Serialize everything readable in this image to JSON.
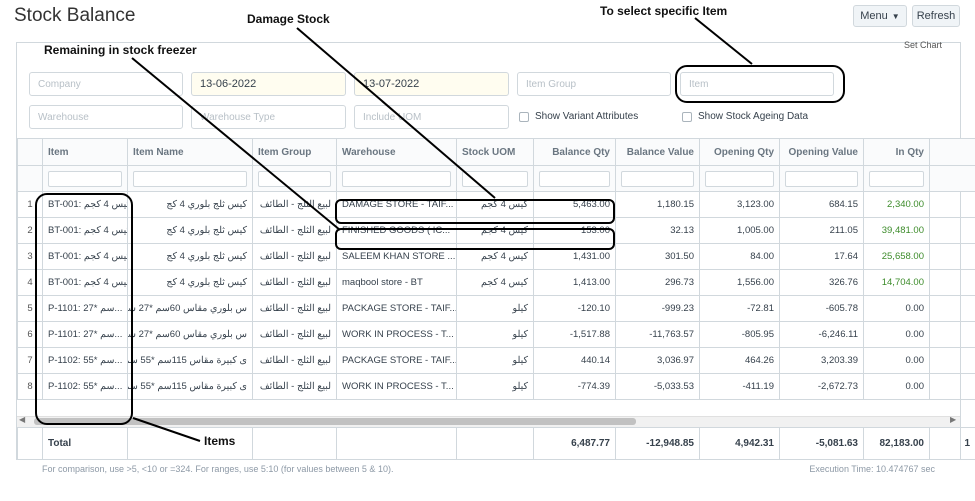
{
  "page": {
    "title": "Stock Balance",
    "menu_label": "Menu",
    "refresh_label": "Refresh",
    "set_chart_label": "Set Chart"
  },
  "filters": {
    "company_placeholder": "Company",
    "from_date": "13-06-2022",
    "to_date": "13-07-2022",
    "item_group_placeholder": "Item Group",
    "item_placeholder": "Item",
    "warehouse_placeholder": "Warehouse",
    "warehouse_type_placeholder": "Warehouse Type",
    "include_uom_placeholder": "Include UOM",
    "show_variant_label": "Show Variant Attributes",
    "show_ageing_label": "Show Stock Ageing Data"
  },
  "table": {
    "columns": [
      "Item",
      "Item Name",
      "Item Group",
      "Warehouse",
      "Stock UOM",
      "Balance Qty",
      "Balance Value",
      "Opening Qty",
      "Opening Value",
      "In Qty"
    ],
    "rows": [
      {
        "idx": "1",
        "item": "BT-001: كيس 4 كجم...",
        "name": "كيس ثلج بلوري 4 كج",
        "group": "لبيع الثلج - الطائف",
        "warehouse": "DAMAGE STORE - TAIF...",
        "uom": "كيس 4 كجم",
        "bal_qty": "5,463.00",
        "bal_val": "1,180.15",
        "open_qty": "3,123.00",
        "open_val": "684.15",
        "in_qty": "2,340.00"
      },
      {
        "idx": "2",
        "item": "BT-001: كيس 4 كجم...",
        "name": "كيس ثلج بلوري 4 كج",
        "group": "لبيع الثلج - الطائف",
        "warehouse": "FINISHED GOODS ( IC...",
        "uom": "كيس 4 كجم",
        "bal_qty": "153.00",
        "bal_val": "32.13",
        "open_qty": "1,005.00",
        "open_val": "211.05",
        "in_qty": "39,481.00"
      },
      {
        "idx": "3",
        "item": "BT-001: كيس 4 كجم...",
        "name": "كيس ثلج بلوري 4 كج",
        "group": "لبيع الثلج - الطائف",
        "warehouse": "SALEEM KHAN STORE ...",
        "uom": "كيس 4 كجم",
        "bal_qty": "1,431.00",
        "bal_val": "301.50",
        "open_qty": "84.00",
        "open_val": "17.64",
        "in_qty": "25,658.00"
      },
      {
        "idx": "4",
        "item": "BT-001: كيس 4 كجم...",
        "name": "كيس ثلج بلوري 4 كج",
        "group": "لبيع الثلج - الطائف",
        "warehouse": "maqbool store - BT",
        "uom": "كيس 4 كجم",
        "bal_qty": "1,413.00",
        "bal_val": "296.73",
        "open_qty": "1,556.00",
        "open_val": "326.76",
        "in_qty": "14,704.00"
      },
      {
        "idx": "5",
        "item": "P-1101: 27* سم...",
        "name": "س بلوري مقاس 60سم *27 سم",
        "group": "لبيع الثلج - الطائف",
        "warehouse": "PACKAGE STORE - TAIF...",
        "uom": "كيلو",
        "bal_qty": "-120.10",
        "bal_val": "-999.23",
        "open_qty": "-72.81",
        "open_val": "-605.78",
        "in_qty": "0.00"
      },
      {
        "idx": "6",
        "item": "P-1101: 27* سم...",
        "name": "س بلوري مقاس 60سم *27 سم",
        "group": "لبيع الثلج - الطائف",
        "warehouse": "WORK IN PROCESS - T...",
        "uom": "كيلو",
        "bal_qty": "-1,517.88",
        "bal_val": "-11,763.57",
        "open_qty": "-805.95",
        "open_val": "-6,246.11",
        "in_qty": "0.00"
      },
      {
        "idx": "7",
        "item": "P-1102: 55* سم...",
        "name": "ى كبيرة مقاس 115سم *55 سم",
        "group": "لبيع الثلج - الطائف",
        "warehouse": "PACKAGE STORE - TAIF...",
        "uom": "كيلو",
        "bal_qty": "440.14",
        "bal_val": "3,036.97",
        "open_qty": "464.26",
        "open_val": "3,203.39",
        "in_qty": "0.00"
      },
      {
        "idx": "8",
        "item": "P-1102: 55* سم...",
        "name": "ى كبيرة مقاس 115سم *55 سم",
        "group": "لبيع الثلج - الطائف",
        "warehouse": "WORK IN PROCESS - T...",
        "uom": "كيلو",
        "bal_qty": "-774.39",
        "bal_val": "-5,033.53",
        "open_qty": "-411.19",
        "open_val": "-2,672.73",
        "in_qty": "0.00"
      }
    ],
    "total": {
      "label": "Total",
      "bal_qty": "6,487.77",
      "bal_val": "-12,948.85",
      "open_qty": "4,942.31",
      "open_val": "-5,081.63",
      "in_qty": "82,183.00",
      "extra": "1"
    }
  },
  "footer": {
    "hint": "For comparison, use >5, <10 or =324. For ranges, use 5:10 (for values between 5 & 10).",
    "execution_time": "Execution Time: 10.474767 sec"
  },
  "annotations": {
    "damage_stock": "Damage Stock",
    "select_item": "To select specific Item",
    "remaining_freezer": "Remaining in stock freezer",
    "items": "Items"
  }
}
